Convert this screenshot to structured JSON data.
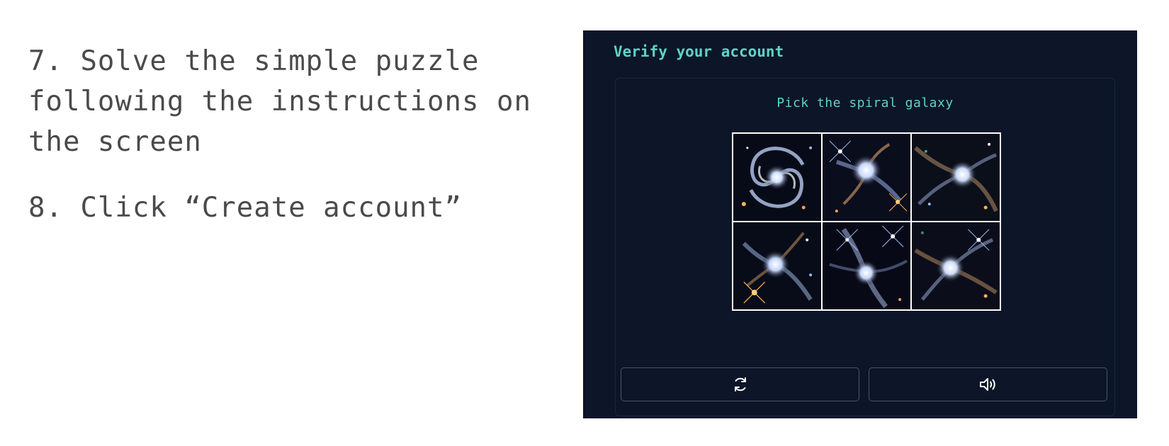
{
  "instructions": {
    "step7": "7. Solve the simple puzzle following the instructions on the screen",
    "step8": "8. Click “Create account”"
  },
  "captcha": {
    "title": "Verify your account",
    "prompt": "Pick the spiral galaxy",
    "tiles": [
      {
        "name": "spiral-galaxy-image"
      },
      {
        "name": "star-cluster-image"
      },
      {
        "name": "star-cluster-image"
      },
      {
        "name": "star-cluster-image"
      },
      {
        "name": "star-cluster-image"
      },
      {
        "name": "star-cluster-image"
      }
    ],
    "refresh_icon": "refresh-icon",
    "audio_icon": "speaker-icon"
  },
  "colors": {
    "panel_bg": "#0c1628",
    "accent": "#5fd3c8",
    "instruction_text": "#4a4a4a",
    "button_border": "#4a5468"
  }
}
